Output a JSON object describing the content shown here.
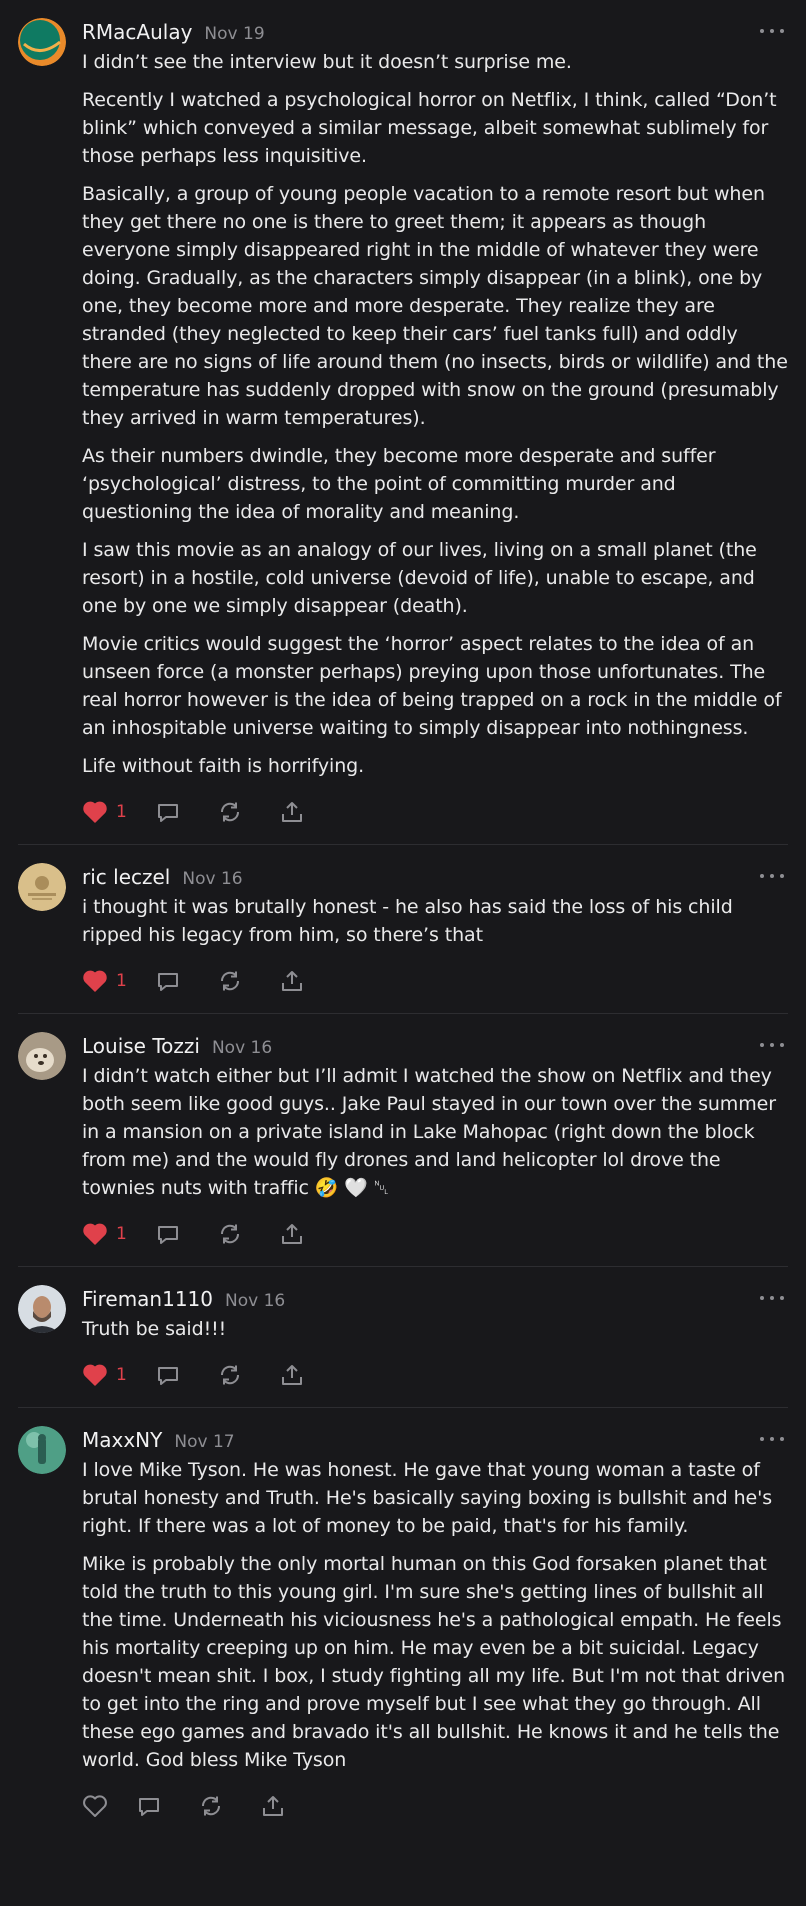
{
  "comments": [
    {
      "author": "RMacAulay",
      "date": "Nov 19",
      "avatar": "green-orange-circle-avatar",
      "liked": true,
      "likes": "1",
      "paragraphs": [
        "I didn’t see the interview but it doesn’t surprise me.",
        "Recently I watched a psychological horror on Netflix, I think, called “Don’t blink” which conveyed a similar message, albeit somewhat sublimely for those perhaps less inquisitive.",
        "Basically, a group of young people vacation to a remote resort but when they get there no one is there to greet them; it appears as though everyone simply disappeared right in the middle of whatever they were doing. Gradually, as the characters simply disappear (in a blink), one by one, they become more and more desperate.   They realize they are stranded (they neglected to keep their cars’ fuel tanks full) and oddly there are no signs of life around them (no insects, birds or wildlife) and the temperature has suddenly dropped with snow on the ground (presumably they arrived in warm temperatures).",
        "As their numbers dwindle, they become more desperate and suffer ‘psychological’ distress, to the point of committing murder and questioning the idea of morality and meaning.",
        "I saw this movie as an analogy of our lives, living on a small planet (the resort) in a hostile, cold universe (devoid of life), unable to escape, and one by one we simply disappear (death).",
        "Movie critics would suggest the ‘horror’ aspect relates to the idea of an unseen force (a monster perhaps) preying upon those unfortunates.   The real horror however is the idea of being trapped on a rock in the middle of an inhospitable universe waiting to simply disappear into nothingness.",
        "Life without faith is horrifying."
      ]
    },
    {
      "author": "ric leczel",
      "date": "Nov 16",
      "avatar": "illustrated-badge-avatar",
      "liked": true,
      "likes": "1",
      "paragraphs": [
        "i thought it was brutally honest - he also has said the loss of his child ripped his legacy from him, so there’s that"
      ]
    },
    {
      "author": "Louise Tozzi",
      "date": "Nov 16",
      "avatar": "dog-photo-avatar",
      "liked": true,
      "likes": "1",
      "paragraphs": [
        "I didn’t watch either but I’ll admit I watched the show on Netflix and they both seem like good guys.. Jake Paul stayed in our town over the summer in a mansion on a private island in Lake Mahopac (right down the block from me) and the would fly drones and land helicopter lol drove the townies nuts with traffic 🤣 🤍 ␀"
      ]
    },
    {
      "author": "Fireman1110",
      "date": "Nov 16",
      "avatar": "bearded-man-photo-avatar",
      "liked": true,
      "likes": "1",
      "paragraphs": [
        "Truth be said!!!"
      ]
    },
    {
      "author": "MaxxNY",
      "date": "Nov 17",
      "avatar": "green-statue-photo-avatar",
      "liked": false,
      "likes": "",
      "paragraphs": [
        "I love Mike Tyson. He was honest. He gave that young woman a taste of brutal honesty and Truth. He's basically saying boxing is bullshit and he's right. If there was a lot of money to be paid, that's for his family.",
        "Mike is probably the only mortal human on this God forsaken planet that told the truth to this young girl. I'm sure she's getting lines of bullshit all the time. Underneath his viciousness he's a pathological empath. He feels his mortality creeping up on him. He may even be a bit suicidal. Legacy doesn't mean shit. I box, I study fighting all my life. But I'm not that driven to get into the ring and prove myself but I see what they go through. All these ego games and bravado it's all bullshit. He knows it and he tells the world. God bless Mike Tyson"
      ]
    }
  ],
  "icons": {
    "like": "heart-icon",
    "reply": "comment-bubble-icon",
    "restack": "restack-arrows-icon",
    "share": "share-upload-icon",
    "more": "more-dots-icon"
  },
  "colors": {
    "background": "#18181b",
    "liked": "#e0414b",
    "icon": "#8e8e93",
    "divider": "#2d2d31"
  }
}
